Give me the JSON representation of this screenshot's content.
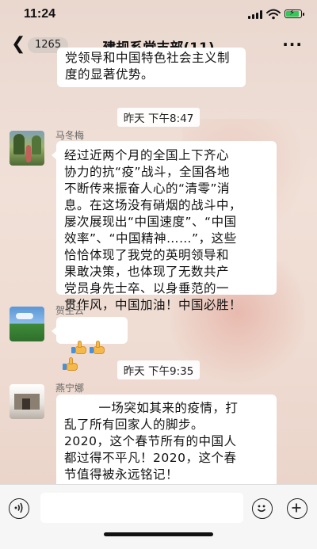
{
  "status_bar": {
    "time": "11:24",
    "battery_color": "#34c759"
  },
  "nav": {
    "back_icon": "chevron-left",
    "unread_count": "1265",
    "title": "建规系党支部(11)",
    "more_label": "···"
  },
  "messages": [
    {
      "type": "text",
      "sender": "",
      "text": "党领导和中国特色社会主义制\n度的显著优势。"
    },
    {
      "type": "timestamp",
      "text": "昨天 下午8:47"
    },
    {
      "type": "text",
      "sender": "马冬梅",
      "text": "经过近两个月的全国上下齐心\n协力的抗“疫”战斗，全国各地\n不断传来振奋人心的“清零”消\n息。在这场没有硝烟的战斗中，\n屡次展现出“中国速度”、“中国\n效率”、“中国精神……”，这些\n恰恰体现了我党的英明领导和\n果敢决策，也体现了无数共产\n党员身先士卒、以身垂范的一\n贯作风，中国加油！中国必胜！"
    },
    {
      "type": "emoji",
      "sender": "贺生云",
      "emoji": [
        "thumbs-up",
        "thumbs-up",
        "thumbs-up"
      ]
    },
    {
      "type": "timestamp",
      "text": "昨天 下午9:35"
    },
    {
      "type": "text",
      "sender": "燕宁娜",
      "text": "        一场突如其来的疫情，打\n乱了所有回家人的脚步。\n2020，这个春节所有的中国人\n都过得不平凡！2020，这个春\n节值得被永远铭记！\n        武汉封城的消息传来的时"
    }
  ],
  "input_bar": {
    "voice_icon": "voice-icon",
    "emoji_icon": "smile-icon",
    "plus_icon": "plus-icon",
    "input_value": ""
  }
}
